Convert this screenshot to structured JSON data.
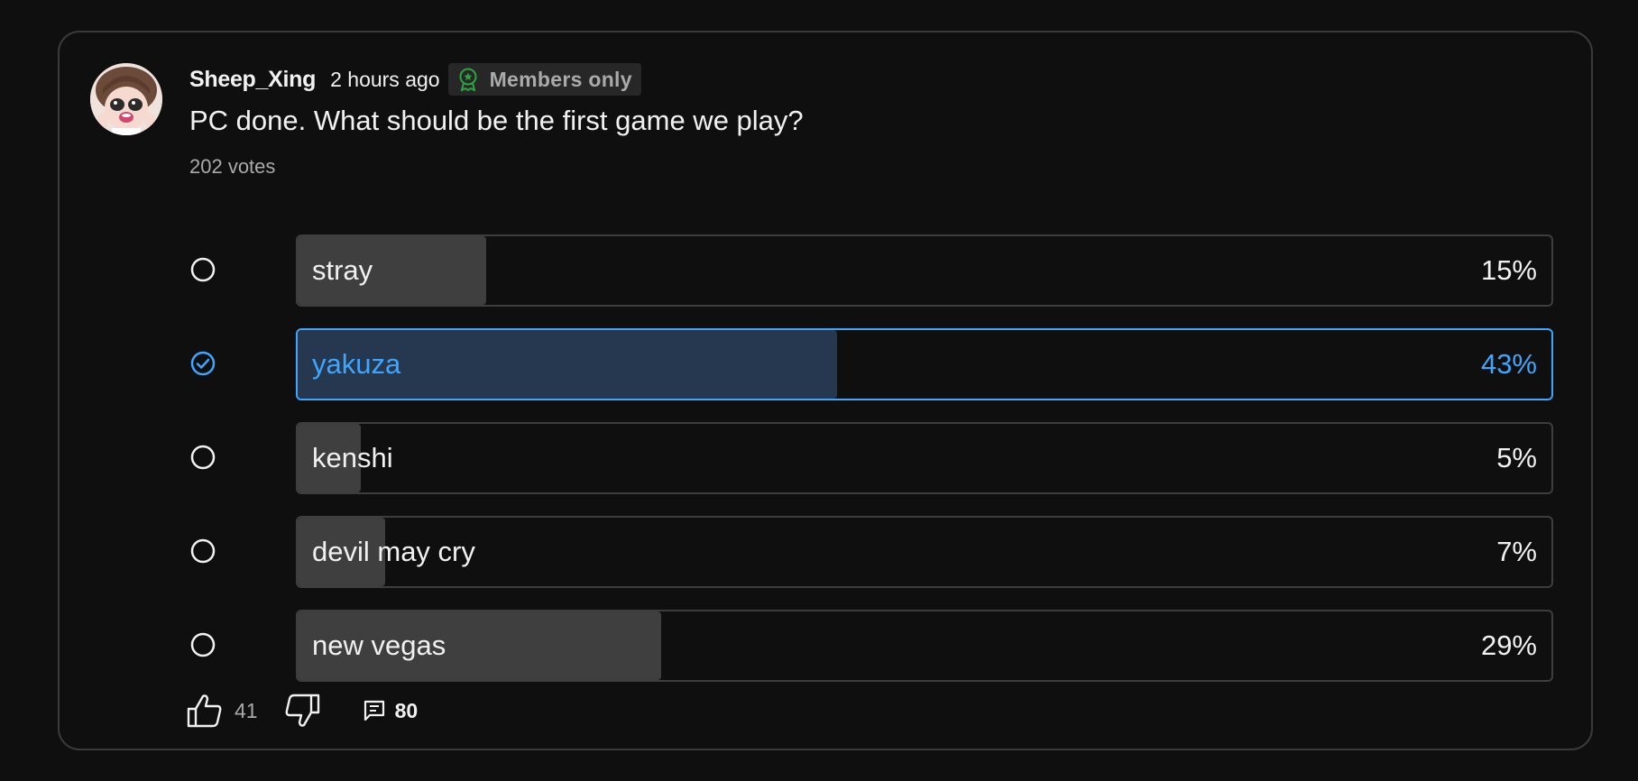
{
  "post": {
    "author": "Sheep_Xing",
    "time": "2 hours ago",
    "badge": "Members only",
    "text": "PC done. What should be the first game we play?",
    "vote_count": "202 votes"
  },
  "poll": {
    "options": [
      {
        "label": "stray",
        "percent_text": "15%",
        "percent": 15,
        "selected": false
      },
      {
        "label": "yakuza",
        "percent_text": "43%",
        "percent": 43,
        "selected": true
      },
      {
        "label": "kenshi",
        "percent_text": "5%",
        "percent": 5,
        "selected": false
      },
      {
        "label": "devil may cry",
        "percent_text": "7%",
        "percent": 7,
        "selected": false
      },
      {
        "label": "new vegas",
        "percent_text": "29%",
        "percent": 29,
        "selected": false
      }
    ]
  },
  "actions": {
    "like_count": "41",
    "comment_count": "80"
  },
  "colors": {
    "background": "#0f0f0f",
    "accent": "#3ea6ff",
    "badge_icon": "#2ba640",
    "bar_fill": "#3f3f3f",
    "selected_fill": "#263850"
  },
  "icons": [
    "avatar",
    "members-badge-icon",
    "radio-icon",
    "check-circle-icon",
    "thumbs-up-icon",
    "thumbs-down-icon",
    "comment-icon"
  ]
}
